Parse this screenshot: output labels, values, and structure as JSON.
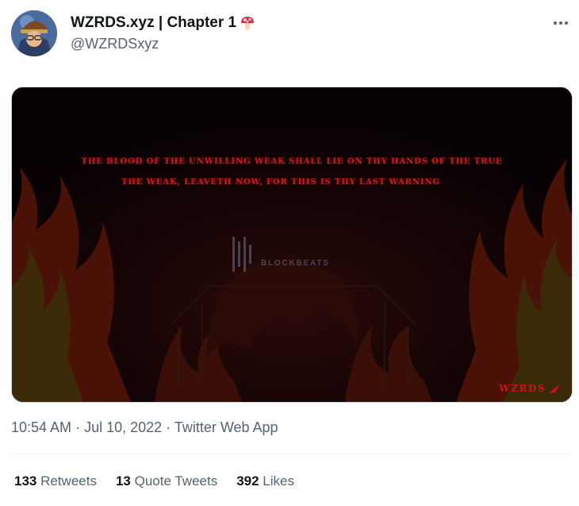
{
  "author": {
    "display_name": "WZRDS.xyz | Chapter 1",
    "handle": "@WZRDSxyz",
    "avatar_icon": "wizard-avatar-icon",
    "name_emoji_icon": "mushroom-icon"
  },
  "menu_icon": "more-options-icon",
  "media": {
    "line1": "THE BLOOD OF THE UNWILLING WEAK SHALL LIE ON THY HANDS OF THE TRUE",
    "line2": "THE WEAK, LEAVETH NOW, FOR THIS IS THY LAST WARNING",
    "watermark_text": "BLOCKBEATS",
    "corner_logo": "WZRDS",
    "text_color": "#d8161b",
    "background_color": "#090204"
  },
  "meta": {
    "time": "10:54 AM",
    "sep1": " · ",
    "date": "Jul 10, 2022",
    "sep2": " · ",
    "app": "Twitter Web App"
  },
  "stats": {
    "retweets_count": "133",
    "retweets_label": " Retweets",
    "quotes_count": "13",
    "quotes_label": " Quote Tweets",
    "likes_count": "392",
    "likes_label": " Likes"
  }
}
